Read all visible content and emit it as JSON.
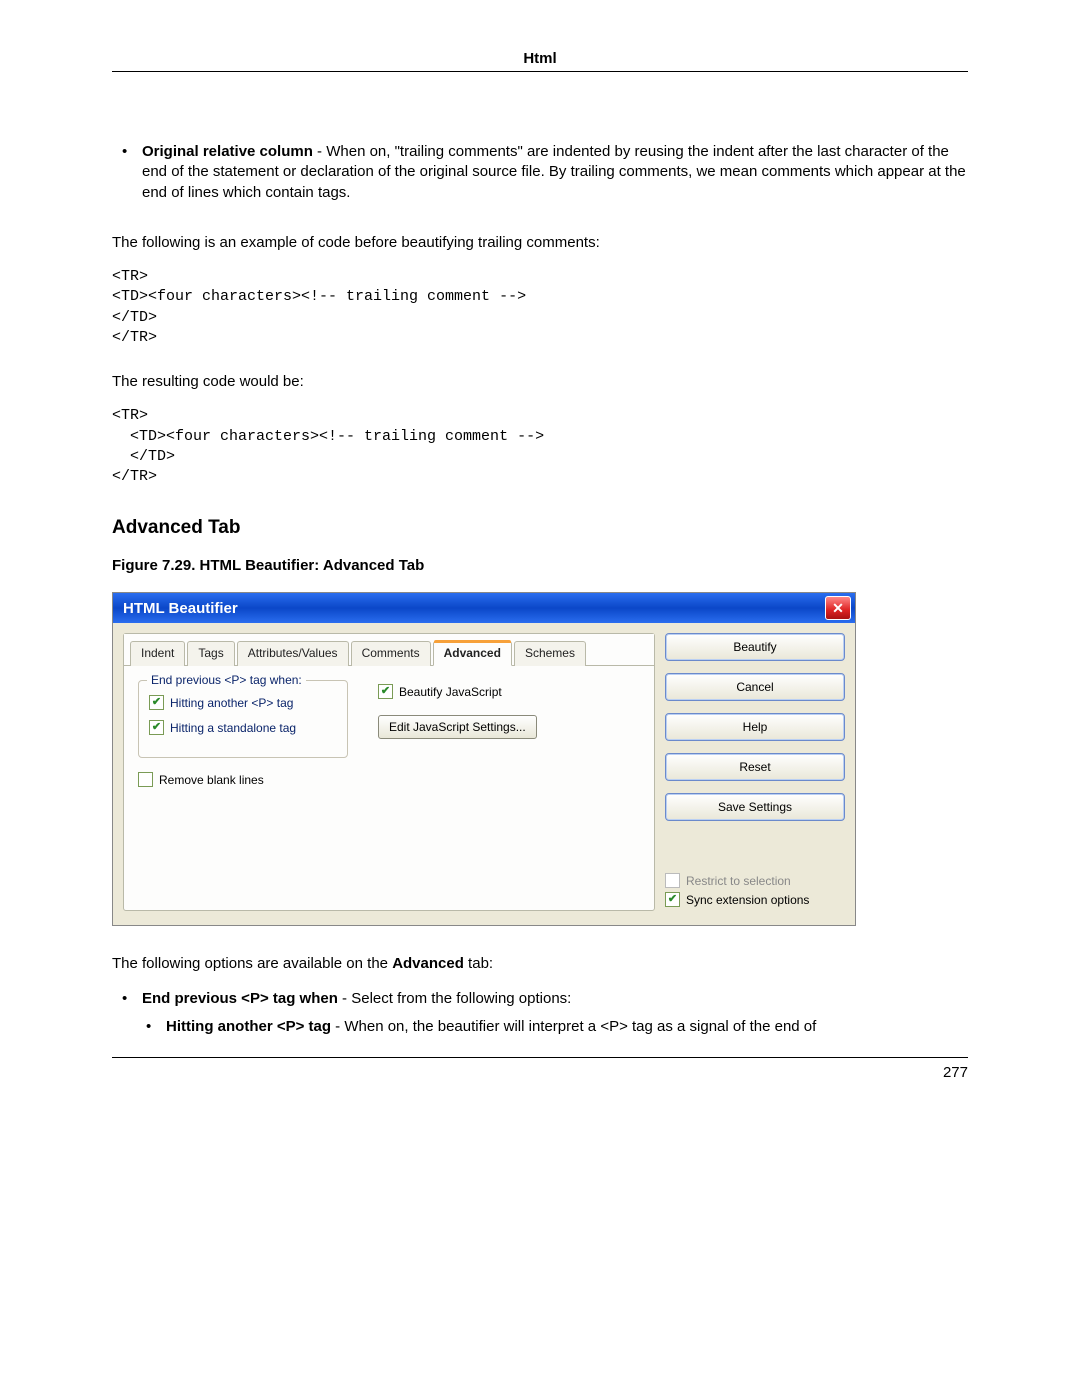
{
  "header": {
    "title": "Html"
  },
  "intro_bullet": {
    "bold": "Original relative column",
    "rest": " - When on, \"trailing comments\" are indented by reusing the indent after the last character of the end of the statement or declaration of the original source file. By trailing comments, we mean comments which appear at the end of lines which contain tags."
  },
  "para1": "The following is an example of code before beautifying trailing comments:",
  "code1": "<TR>\n<TD><four characters><!-- trailing comment -->\n</TD>\n</TR>",
  "para2": "The resulting code would be:",
  "code2": "<TR>\n  <TD><four characters><!-- trailing comment -->\n  </TD>\n</TR>",
  "section_heading": "Advanced Tab",
  "figure_caption": "Figure 7.29. HTML Beautifier: Advanced Tab",
  "dialog": {
    "title": "HTML Beautifier",
    "tabs": [
      "Indent",
      "Tags",
      "Attributes/Values",
      "Comments",
      "Advanced",
      "Schemes"
    ],
    "active_tab_index": 4,
    "group_legend": "End previous <P> tag when:",
    "chk_hit_p": "Hitting another <P> tag",
    "chk_hit_standalone": "Hitting a standalone tag",
    "chk_remove_blank": "Remove blank lines",
    "chk_beautify_js": "Beautify JavaScript",
    "btn_edit_js": "Edit JavaScript Settings...",
    "buttons": {
      "beautify": "Beautify",
      "cancel": "Cancel",
      "help": "Help",
      "reset": "Reset",
      "save": "Save Settings"
    },
    "chk_restrict": "Restrict to selection",
    "chk_sync": "Sync extension options"
  },
  "after_fig_para_pre": "The following options are available on the ",
  "after_fig_para_bold": "Advanced",
  "after_fig_para_post": " tab:",
  "bullet2": {
    "bold": "End previous <P> tag when",
    "rest": " - Select from the following options:"
  },
  "bullet3": {
    "bold": "Hitting another <P> tag",
    "rest": " - When on, the beautifier will interpret a <P> tag as a signal of the end of"
  },
  "page_number": "277"
}
